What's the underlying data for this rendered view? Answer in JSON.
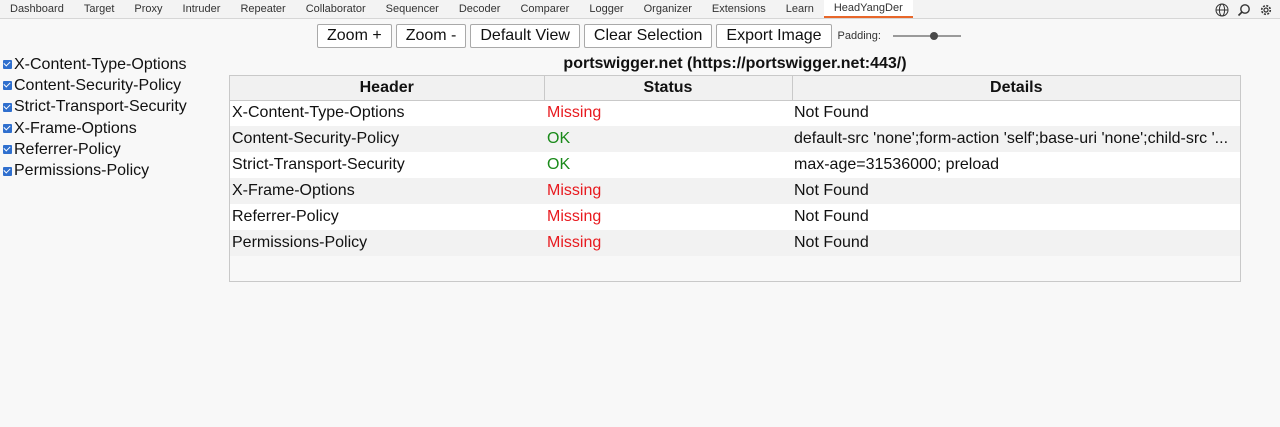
{
  "tabbar": {
    "tabs": [
      "Dashboard",
      "Target",
      "Proxy",
      "Intruder",
      "Repeater",
      "Collaborator",
      "Sequencer",
      "Decoder",
      "Comparer",
      "Logger",
      "Organizer",
      "Extensions",
      "Learn",
      "HeadYangDer"
    ],
    "active_tab": "HeadYangDer",
    "icons": [
      "globe-icon",
      "search-icon",
      "gear-icon"
    ]
  },
  "toolbar": {
    "zoom_in_label": "Zoom +",
    "zoom_out_label": "Zoom -",
    "default_view_label": "Default View",
    "clear_selection_label": "Clear Selection",
    "export_image_label": "Export Image",
    "padding_label": "Padding:",
    "padding_value": 0.6
  },
  "header_filters": [
    {
      "label": "X-Content-Type-Options",
      "checked": true
    },
    {
      "label": "Content-Security-Policy",
      "checked": true
    },
    {
      "label": "Strict-Transport-Security",
      "checked": true
    },
    {
      "label": "X-Frame-Options",
      "checked": true
    },
    {
      "label": "Referrer-Policy",
      "checked": true
    },
    {
      "label": "Permissions-Policy",
      "checked": true
    }
  ],
  "site_title": "portswigger.net (https://portswigger.net:443/)",
  "table": {
    "columns": [
      "Header",
      "Status",
      "Details"
    ],
    "rows": [
      {
        "header": "X-Content-Type-Options",
        "status": "Missing",
        "details": "Not Found"
      },
      {
        "header": "Content-Security-Policy",
        "status": "OK",
        "details": "default-src 'none';form-action 'self';base-uri 'none';child-src '..."
      },
      {
        "header": "Strict-Transport-Security",
        "status": "OK",
        "details": "max-age=31536000; preload"
      },
      {
        "header": "X-Frame-Options",
        "status": "Missing",
        "details": "Not Found"
      },
      {
        "header": "Referrer-Policy",
        "status": "Missing",
        "details": "Not Found"
      },
      {
        "header": "Permissions-Policy",
        "status": "Missing",
        "details": "Not Found"
      }
    ]
  },
  "colors": {
    "missing": "#e8191e",
    "ok": "#1a8a1a",
    "active_tab_underline": "#e8672a",
    "checkbox": "#2f6fce"
  }
}
